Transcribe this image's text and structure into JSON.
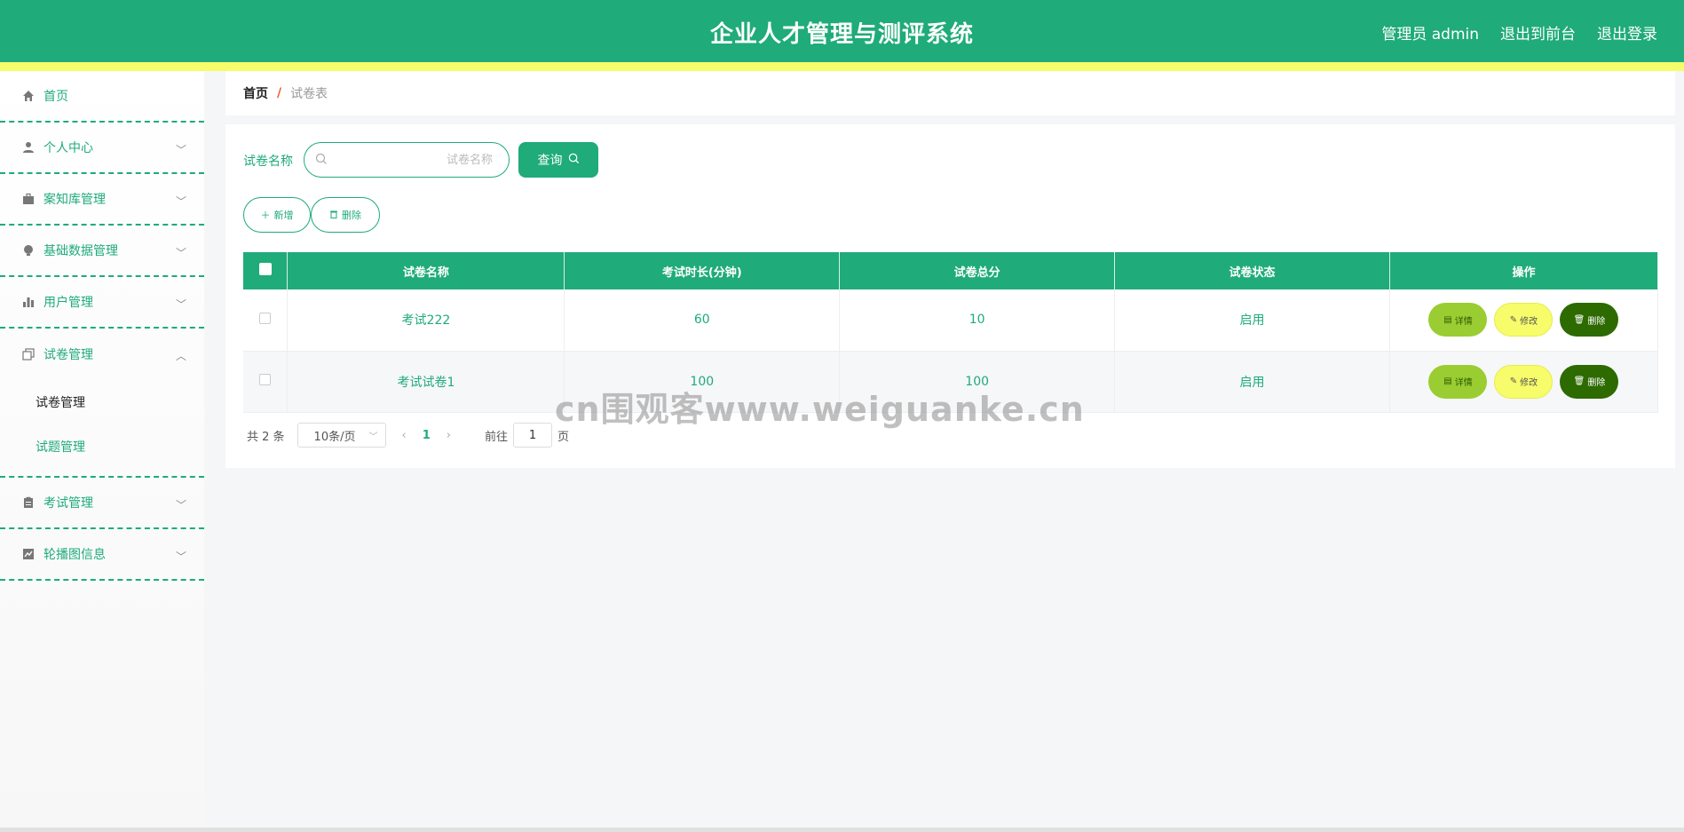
{
  "header": {
    "title": "企业人才管理与测评系统",
    "user_label": "管理员 admin",
    "front_link": "退出到前台",
    "logout_link": "退出登录"
  },
  "sidebar": {
    "items": [
      {
        "label": "首页",
        "icon": "home-icon"
      },
      {
        "label": "个人中心",
        "icon": "user-icon"
      },
      {
        "label": "案知库管理",
        "icon": "briefcase-icon"
      },
      {
        "label": "基础数据管理",
        "icon": "bulb-icon"
      },
      {
        "label": "用户管理",
        "icon": "bar-chart-icon"
      },
      {
        "label": "试卷管理",
        "icon": "copy-icon",
        "children": [
          "试卷管理",
          "试题管理"
        ]
      },
      {
        "label": "考试管理",
        "icon": "clipboard-icon"
      },
      {
        "label": "轮播图信息",
        "icon": "line-chart-icon"
      }
    ]
  },
  "breadcrumb": {
    "home": "首页",
    "separator": "/",
    "current": "试卷表"
  },
  "search": {
    "label": "试卷名称",
    "placeholder": "试卷名称",
    "button": "查询"
  },
  "actions": {
    "add": "新增",
    "delete": "删除"
  },
  "table": {
    "headers": [
      "试卷名称",
      "考试时长(分钟)",
      "试卷总分",
      "试卷状态",
      "操作"
    ],
    "rows": [
      {
        "name": "考试222",
        "duration": "60",
        "score": "10",
        "status": "启用"
      },
      {
        "name": "考试试卷1",
        "duration": "100",
        "score": "100",
        "status": "启用"
      }
    ],
    "row_buttons": {
      "detail": "详情",
      "edit": "修改",
      "delete": "删除"
    }
  },
  "pagination": {
    "total": "共 2 条",
    "page_size": "10条/页",
    "current_page": "1",
    "goto_prefix": "前往",
    "goto_value": "1",
    "goto_suffix": "页"
  },
  "watermark": "cn围观客www.weiguanke.cn",
  "colors": {
    "primary": "#1fab7a",
    "accent_yellow": "#f7fc6a",
    "detail_green": "#9acd32",
    "delete_dark": "#2d6a00"
  }
}
